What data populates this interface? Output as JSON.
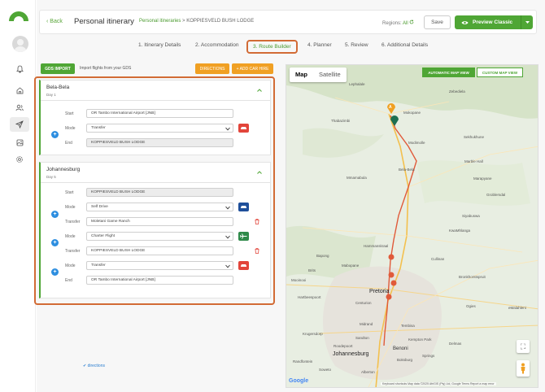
{
  "sidebar": {
    "icons": [
      "bell-icon",
      "home-icon",
      "users-icon",
      "send-icon",
      "image-icon",
      "settings-icon"
    ]
  },
  "header": {
    "back_label": "Back",
    "title": "Personal itinerary",
    "breadcrumb_link": "Personal itineraries",
    "breadcrumb_sep": ">",
    "breadcrumb_current": "KOPPIESVELD BUSH LODGE",
    "regions_label": "Regions:",
    "regions_value": "All",
    "save_label": "Save",
    "preview_label": "Preview Classic"
  },
  "tabs": [
    {
      "label": "1. Itinerary Details"
    },
    {
      "label": "2. Accommodation"
    },
    {
      "label": "3. Route Builder"
    },
    {
      "label": "4. Planner"
    },
    {
      "label": "5. Review"
    },
    {
      "label": "6. Additional Details"
    }
  ],
  "toolbar": {
    "gds_label": "GDS IMPORT",
    "gds_text": "Import flights from your GDS",
    "directions_label": "DIRECTIONS",
    "car_hire_label": "+ ADD CAR HIRE"
  },
  "days": [
    {
      "title": "Bela-Bela",
      "sub": "Day 1",
      "rows": [
        {
          "label": "Start",
          "value": "OR Tambo International Airport [JNB]"
        },
        {
          "label": "Mode",
          "value": "Transfer"
        },
        {
          "label": "End",
          "value": "KOPPIESVELD BUSH LODGE"
        }
      ]
    },
    {
      "title": "Johannesburg",
      "sub": "Day 5",
      "rows": [
        {
          "label": "Start",
          "value": "KOPPIESVELD BUSH LODGE"
        },
        {
          "label": "Mode",
          "value": "Self Drive"
        },
        {
          "label": "Transfer",
          "value": "Moletani Game Ranch"
        },
        {
          "label": "Mode",
          "value": "Charter Flight"
        },
        {
          "label": "Transfer",
          "value": "KOPPIESVELD BUSH LODGE"
        },
        {
          "label": "Mode",
          "value": "Transfer"
        },
        {
          "label": "End",
          "value": "OR Tambo International Airport [JNB]"
        }
      ],
      "directions_label": "directions"
    }
  ],
  "map": {
    "type_map": "Map",
    "type_satellite": "Satellite",
    "auto_view": "AUTOMATIC MAP VIEW",
    "custom_view": "CUSTOM MAP VIEW",
    "marker_label": "A",
    "labels": {
      "mokopane": "Mokopane",
      "pretoria": "Pretoria",
      "johannesburg": "Johannesburg",
      "centurion": "Centurion",
      "midrand": "Midrand",
      "sandton": "Sandton",
      "roodepoort": "Roodepoort",
      "krugersdorp": "Krugersdorp",
      "benoni": "Benoni",
      "alberton": "Alberton",
      "emalahleni": "eMalahleni",
      "modimolle": "Modimolle",
      "bela_bela": "Bela-Bela",
      "lephalale": "Lephalale",
      "thabazimbi": "Thabazimbi",
      "mmamabula": "Mmamabula",
      "marapyane": "Marapyane",
      "kwamhlanga": "KwaMhlanga",
      "siyabuswa": "Siyabuswa",
      "mabopane": "Mabopane",
      "hammanskraal": "Hammanskraal",
      "brits": "Brits",
      "bapong": "Bapong",
      "mooinooi": "Mooinooi",
      "bronkhorstspruit": "Bronkhorstspruit",
      "cullinan": "Cullinan",
      "tembisa": "Tembisa",
      "kempton_park": "Kempton Park",
      "boksburg": "Boksburg",
      "springs": "Springs",
      "delmas": "Delmas",
      "randfontein": "Randfontein",
      "soweto": "Soweto",
      "magaliesburg": "Magaliesburg",
      "hartbeespoort": "Hartbeespoort",
      "rustenburg": "Rustenburg",
      "ogies": "Ogies",
      "kriel": "Kriel",
      "groblersdal": "Groblersdal",
      "sekhukhune": "Sekhukhune",
      "marble_hall": "Marble Hall",
      "sabie_river": "Sabie River",
      "zebediela": "Zebediela",
      "naboomspruit": "Naboomspruit",
      "mookgophong": "Mookgophong"
    },
    "google": "Google",
    "attribution": "Keyboard shortcuts   Map data ©2025 AfriGIS (Pty) Ltd, Google   Terms   Report a map error"
  }
}
